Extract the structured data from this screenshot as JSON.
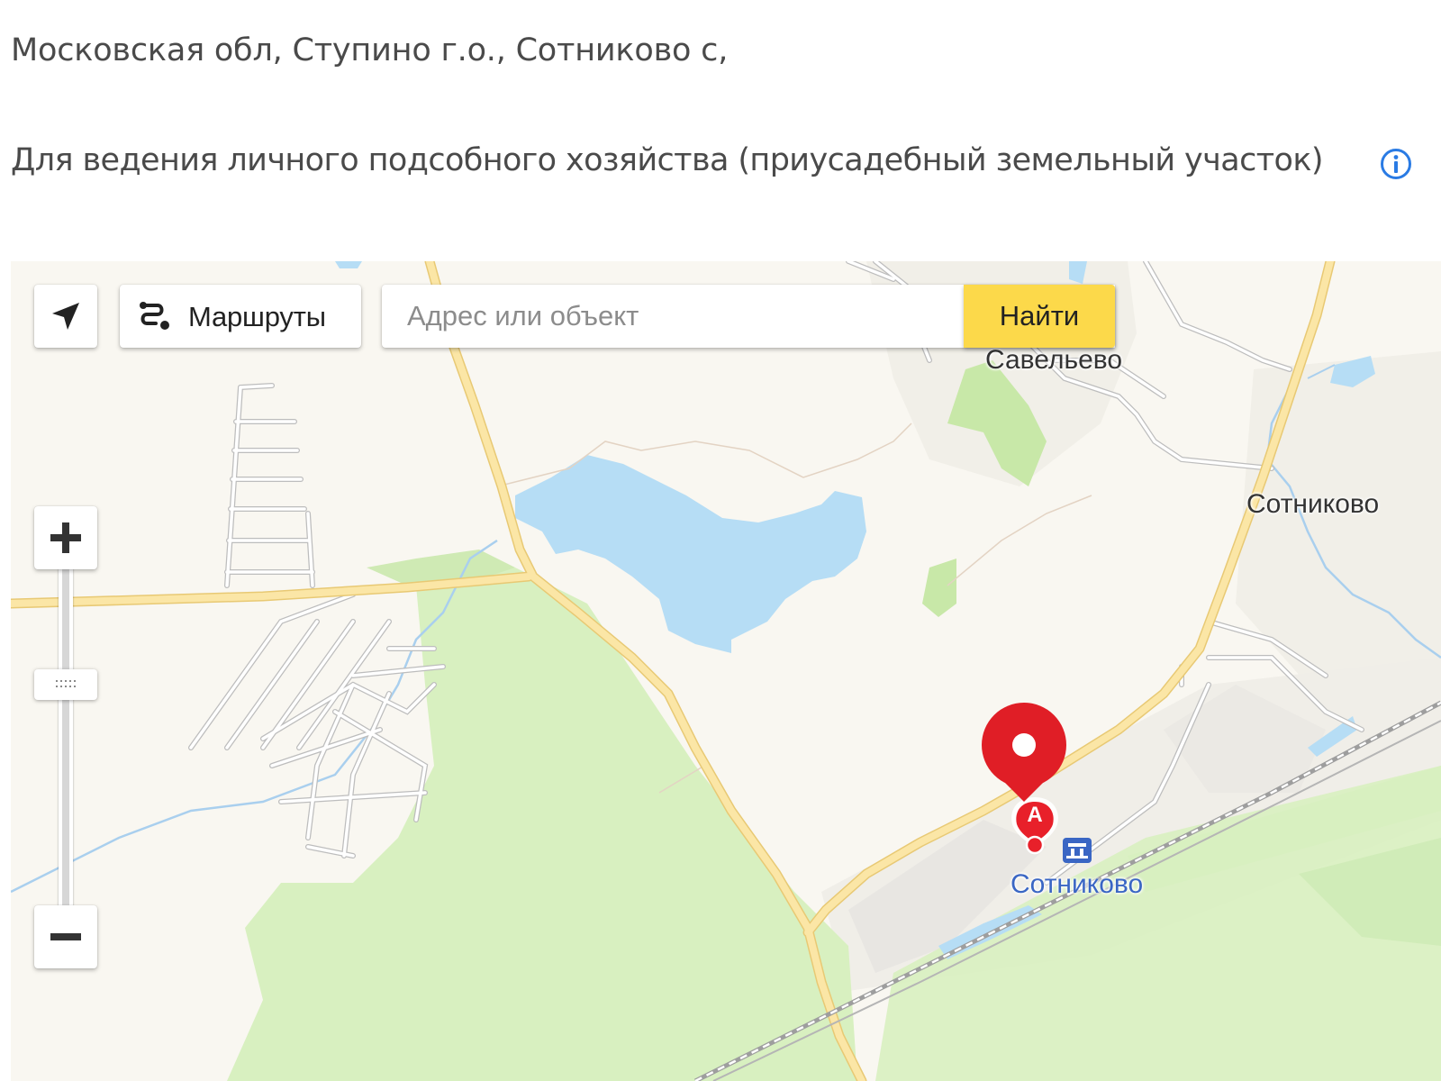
{
  "listing": {
    "address": "Московская обл, Ступино г.о., Сотниково с,",
    "land_use": "Для ведения личного подсобного хозяйства (приусадебный земельный участок)"
  },
  "map": {
    "toolbar": {
      "routes_label": "Маршруты",
      "search_placeholder": "Адрес или объект",
      "search_button_label": "Найти"
    },
    "places": {
      "village_north": "Савельево",
      "village_east": "Сотниково",
      "station": "Сотниково"
    },
    "marker_letter": "A",
    "colors": {
      "search_button": "#fcd94a",
      "marker": "#e8202a",
      "water": "#b6ddf5",
      "forest": "#d8f0c0",
      "road": "#f8e29a",
      "station": "#3a66c4",
      "info_icon": "#2a7be4"
    },
    "icons": [
      "locate-arrow-icon",
      "routes-icon",
      "zoom-in-icon",
      "zoom-out-icon",
      "station-icon",
      "placemark-icon",
      "info-icon"
    ]
  }
}
